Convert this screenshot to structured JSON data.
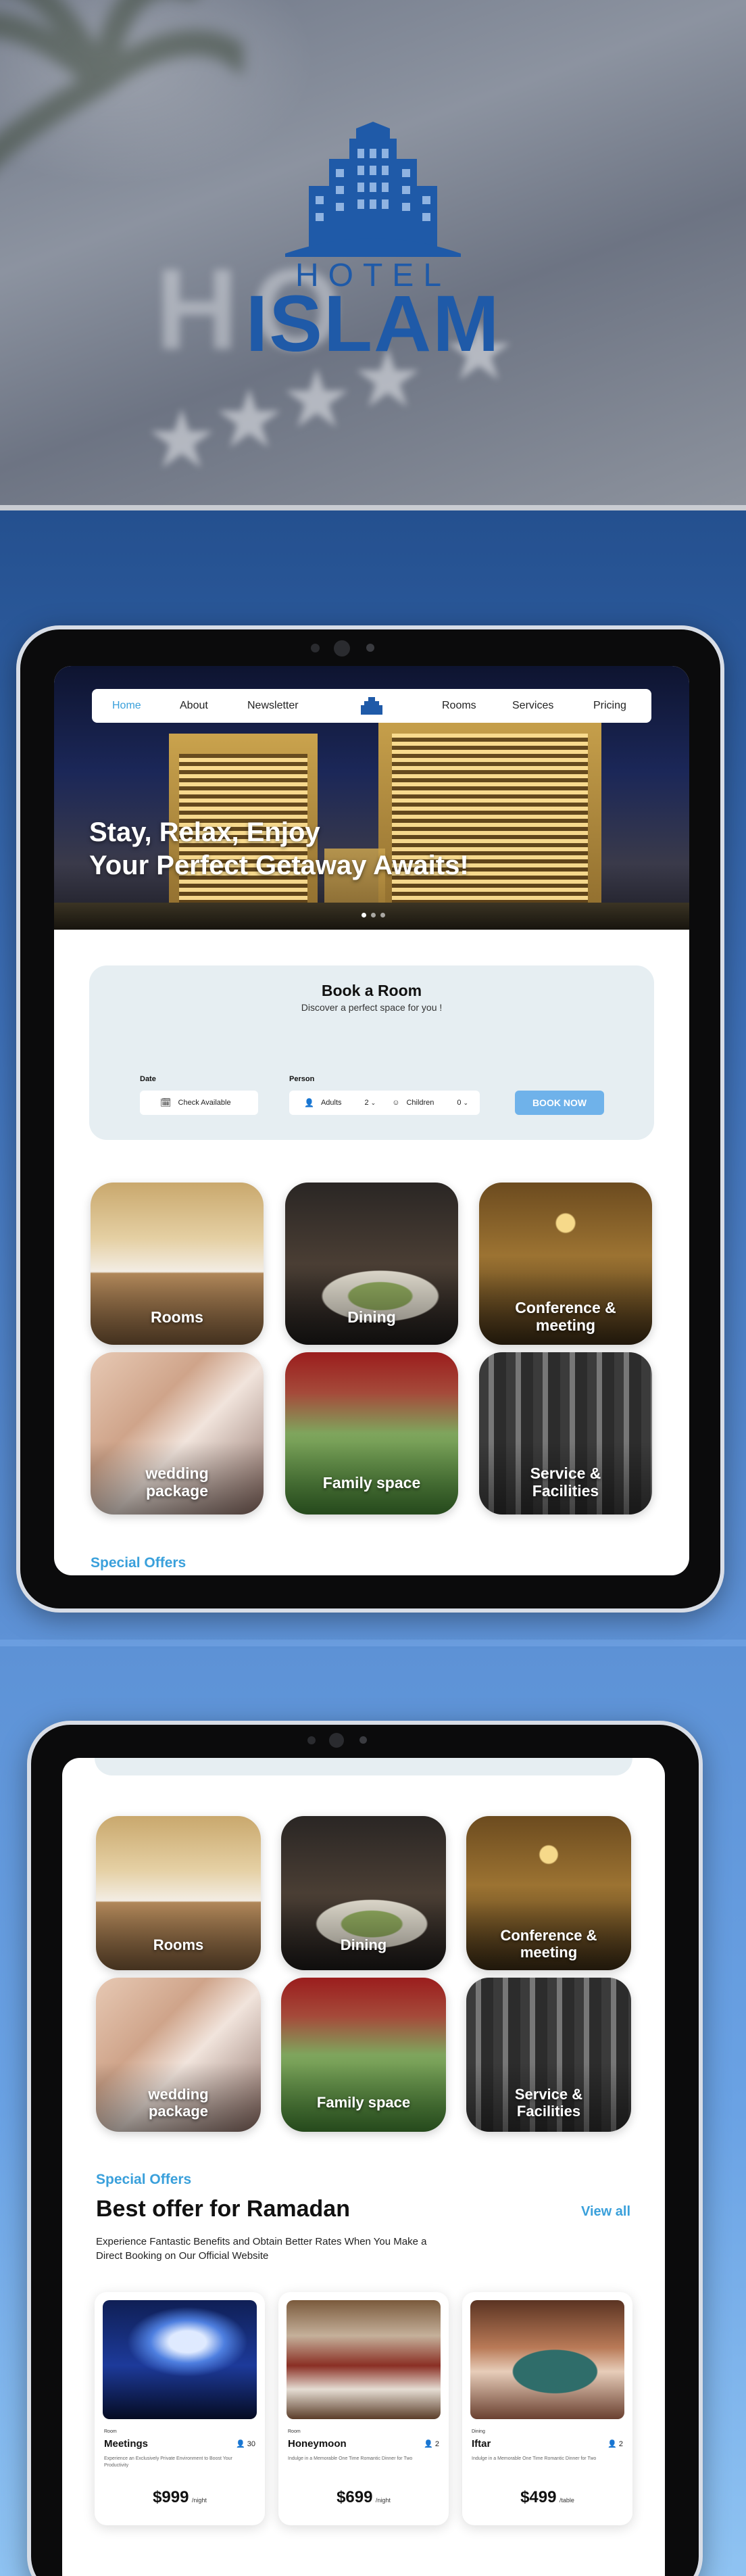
{
  "logo": {
    "line1": "HOTEL",
    "line2": "ISLAM"
  },
  "nav": {
    "items": [
      {
        "label": "Home",
        "active": true
      },
      {
        "label": "About"
      },
      {
        "label": "Newsletter"
      },
      {
        "label": "Rooms"
      },
      {
        "label": "Services"
      },
      {
        "label": "Pricing"
      }
    ]
  },
  "hero": {
    "title_line1": "Stay, Relax, Enjoy",
    "title_line2": "Your Perfect Getaway Awaits!",
    "slide_count": 3,
    "active_slide": 1
  },
  "booking": {
    "title": "Book a Room",
    "subtitle": "Discover a perfect space for you !",
    "date_label": "Date",
    "date_field": "Check Available",
    "person_label": "Person",
    "adults_label": "Adults",
    "adults_value": "2",
    "children_label": "Children",
    "children_value": "0",
    "button": "BOOK NOW"
  },
  "categories": [
    {
      "line1": "Rooms",
      "line2": ""
    },
    {
      "line1": "Dining",
      "line2": ""
    },
    {
      "line1": "Conference &",
      "line2": "meeting"
    },
    {
      "line1": "wedding",
      "line2": "package"
    },
    {
      "line1": "Family space",
      "line2": ""
    },
    {
      "line1": "Service &",
      "line2": "Facilities"
    }
  ],
  "offers_section": {
    "tag": "Special Offers",
    "title": "Best offer for Ramadan",
    "view_all": "View all",
    "subtitle": "Experience Fantastic Benefits and Obtain Better Rates When You Make a Direct Booking on Our Official Website"
  },
  "offers": [
    {
      "category": "Room",
      "name": "Meetings",
      "persons": "30",
      "desc": "Experience an Exclusively Private Environment to Boost Your Productivity",
      "price": "$999",
      "unit": "/night"
    },
    {
      "category": "Room",
      "name": "Honeymoon",
      "persons": "2",
      "desc": "Indulge in a Memorable One Time Romantic Dinner for Two",
      "price": "$699",
      "unit": "/night"
    },
    {
      "category": "Dining",
      "name": "Iftar",
      "persons": "2",
      "desc": "Indulge in a Memorable One Time Romantic Dinner for Two",
      "price": "$499",
      "unit": "/table"
    }
  ],
  "colors": {
    "brand": "#1f5aa8",
    "accent": "#3aa0db",
    "button": "#6fb2ea",
    "panel": "#e6eef2"
  }
}
